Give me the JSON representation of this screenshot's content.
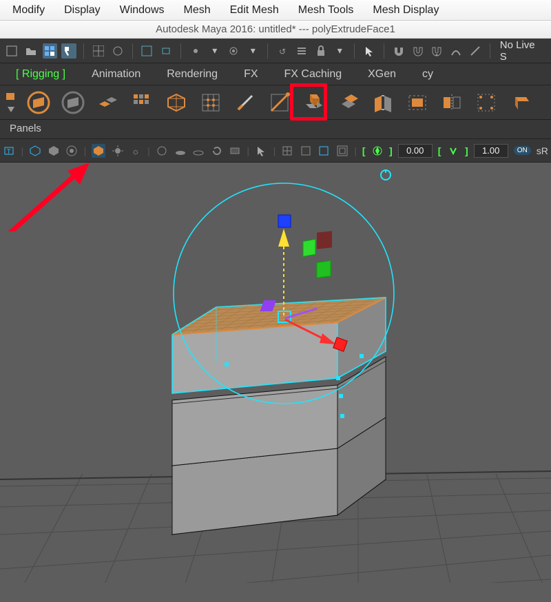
{
  "os_menu": [
    "Modify",
    "Display",
    "Windows",
    "Mesh",
    "Edit Mesh",
    "Mesh Tools",
    "Mesh Display"
  ],
  "title": "Autodesk Maya 2016: untitled*   ---   polyExtrudeFace1",
  "toolbar1": {
    "nolive": "No Live S"
  },
  "tabs": [
    "Rigging",
    "Animation",
    "Rendering",
    "FX",
    "FX Caching",
    "XGen",
    "cy"
  ],
  "panels_label": "Panels",
  "viewport_fields": {
    "a": "0.00",
    "b": "1.00",
    "srgb": "sR"
  },
  "shelf_icons": [
    "shelf-icon-1",
    "shelf-icon-2",
    "shelf-icon-3",
    "shelf-icon-4",
    "shelf-icon-5",
    "shelf-icon-6",
    "shelf-icon-7",
    "shelf-icon-8",
    "shelf-icon-multicut",
    "shelf-icon-extrude",
    "shelf-icon-11",
    "shelf-icon-12",
    "shelf-icon-13",
    "shelf-icon-14",
    "shelf-icon-15",
    "shelf-icon-16"
  ],
  "highlight_index": 9,
  "colors": {
    "accent": "#dd8a3d",
    "grid": "#4a4a4a",
    "select_cyan": "#1fe5ff",
    "axis_x": "#ff2020",
    "axis_y": "#20ff20",
    "axis_z": "#2050ff",
    "manip_yellow": "#ffe030",
    "annotation": "#ff0022"
  }
}
